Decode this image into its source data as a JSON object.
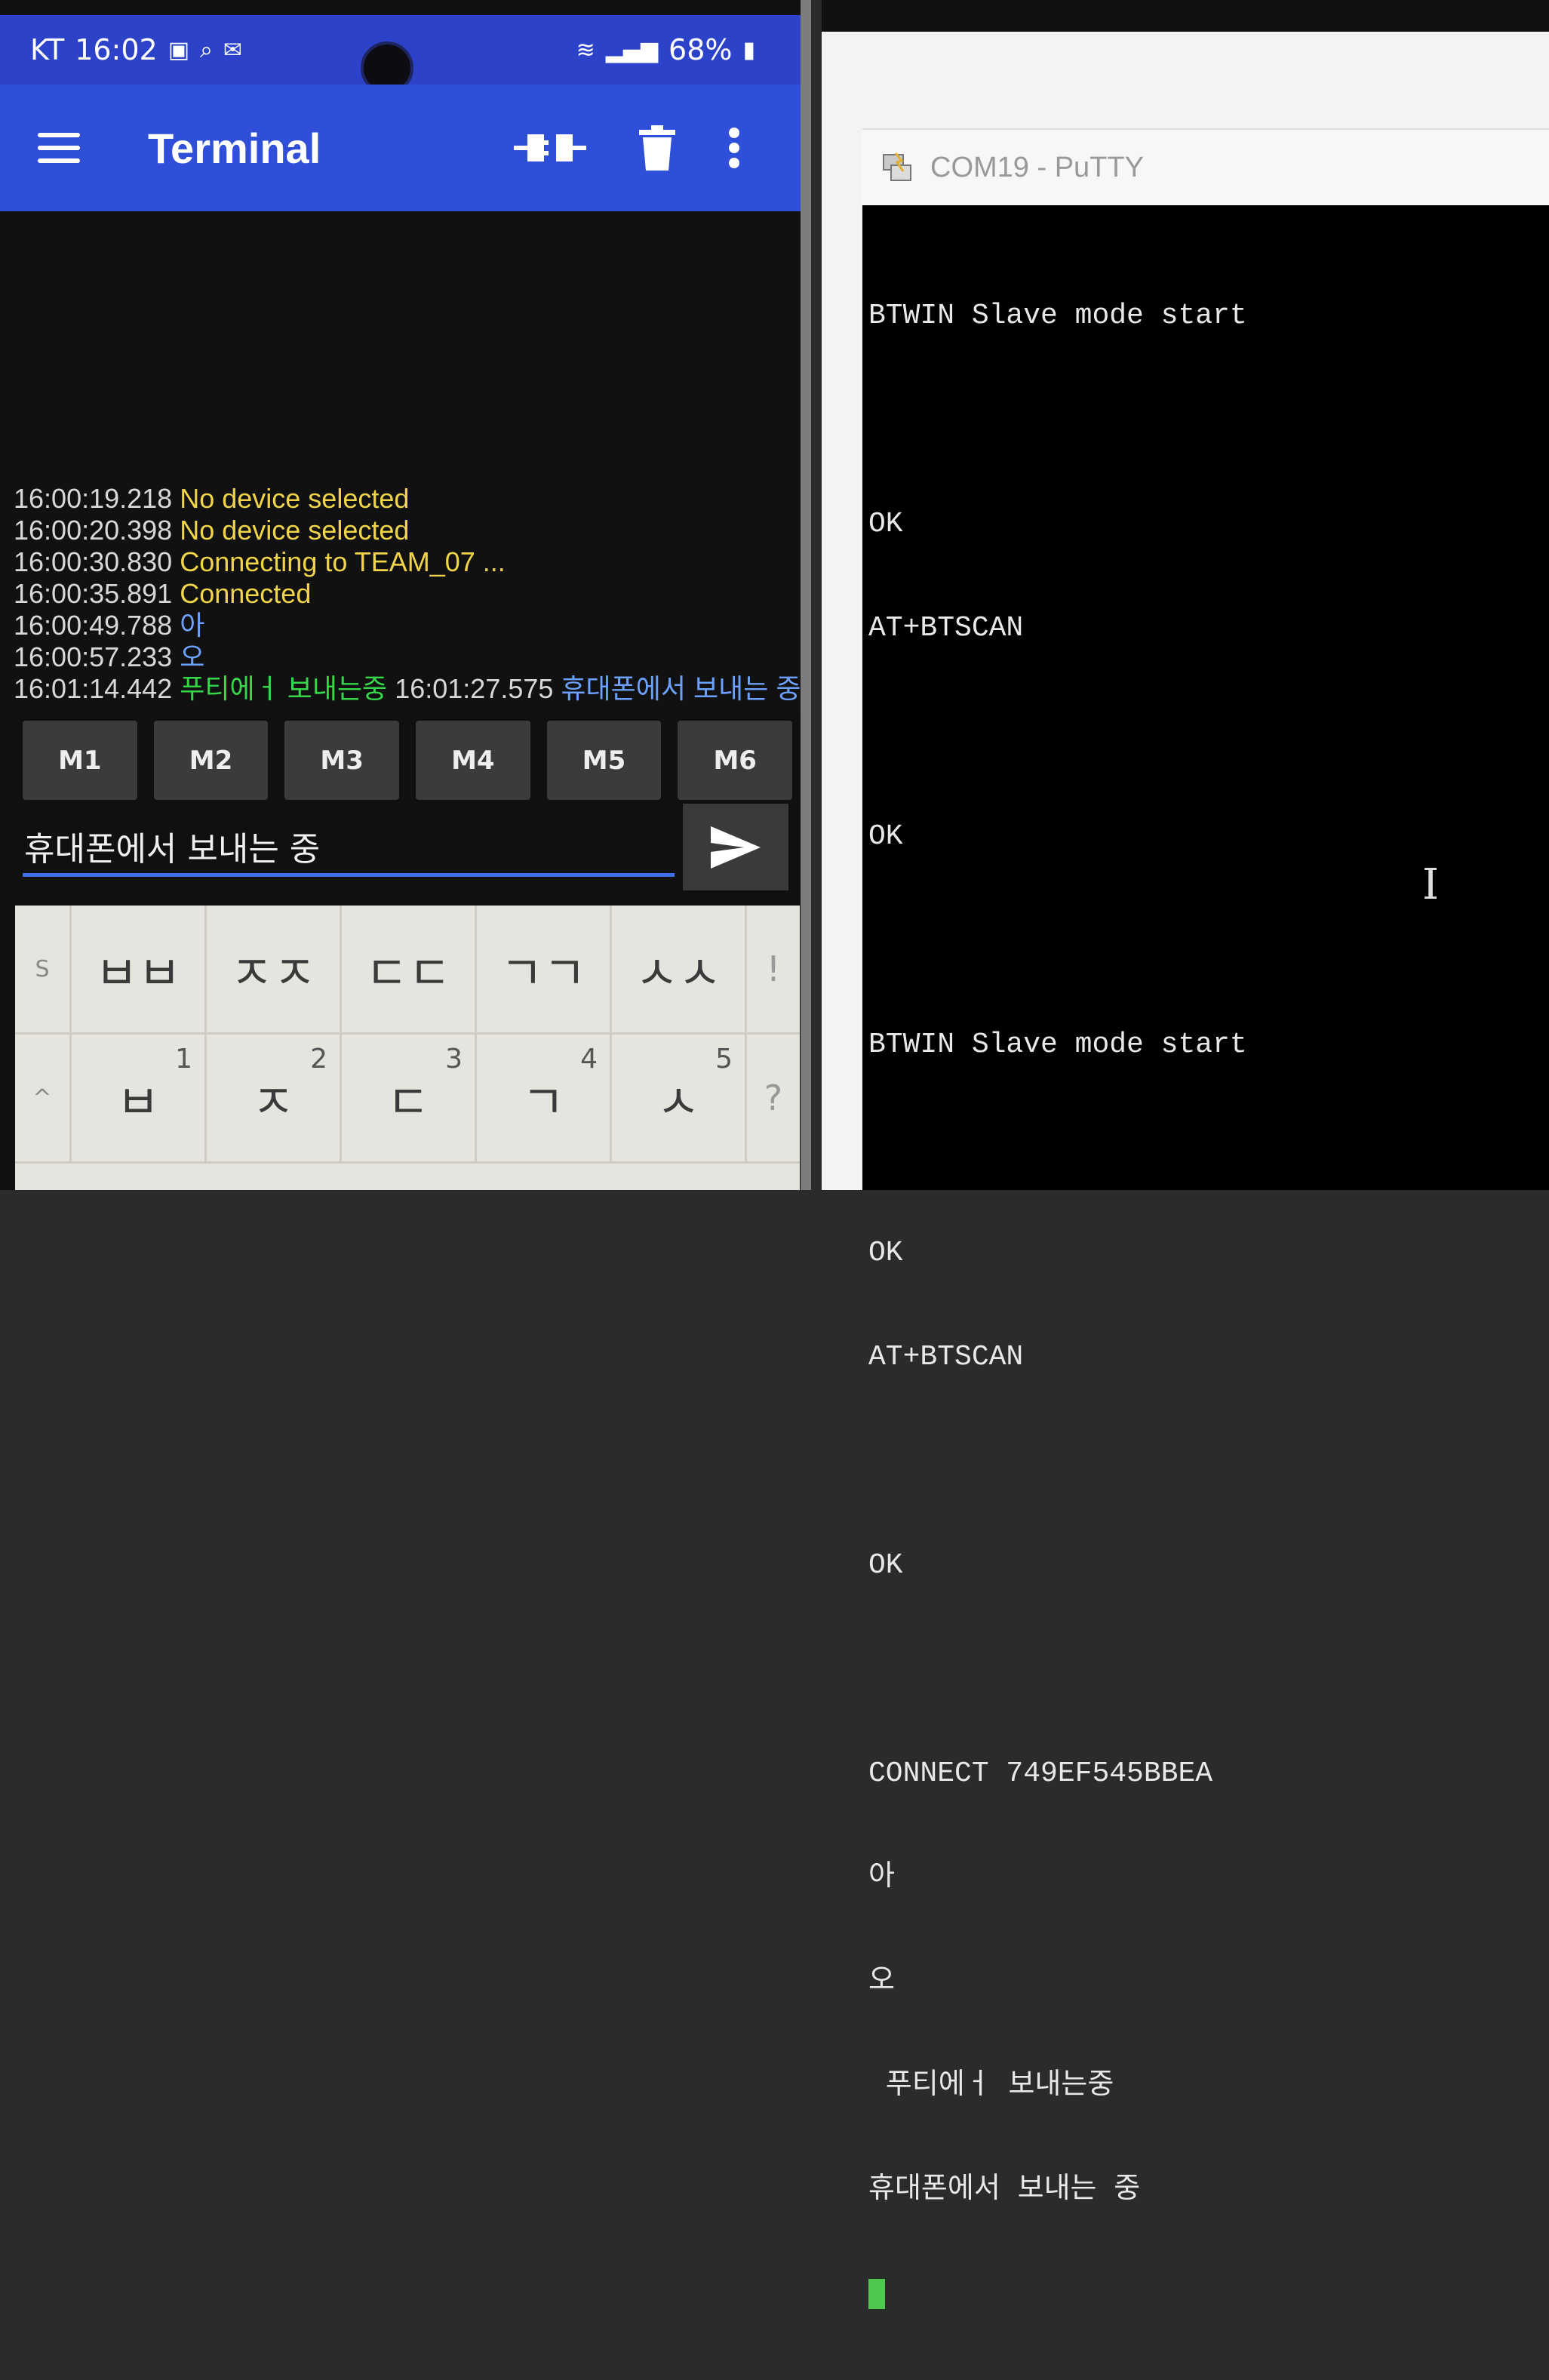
{
  "phone": {
    "status_bar": {
      "carrier": "KT",
      "time": "16:02",
      "battery": "68%"
    },
    "app_bar": {
      "title": "Terminal",
      "icons": [
        "menu-icon",
        "connect-icon",
        "delete-icon",
        "more-icon"
      ]
    },
    "log": [
      {
        "time": "16:00:19.218",
        "text": "No device selected",
        "kind": "status"
      },
      {
        "time": "16:00:20.398",
        "text": "No device selected",
        "kind": "status"
      },
      {
        "time": "16:00:30.830",
        "text": "Connecting to TEAM_07 ...",
        "kind": "status"
      },
      {
        "time": "16:00:35.891",
        "text": "Connected",
        "kind": "status"
      },
      {
        "time": "16:00:49.788",
        "text": "아",
        "kind": "recv"
      },
      {
        "time": "16:00:57.233",
        "text": "오",
        "kind": "recv"
      },
      {
        "time": "16:01:14.442",
        "text": "푸티에ㅓ 보내는중",
        "kind": "send",
        "time2": "16:01:27.575",
        "text2": "휴대폰에서 보내는 중"
      }
    ],
    "macros": [
      "M1",
      "M2",
      "M3",
      "M4",
      "M5",
      "M6"
    ],
    "input": {
      "value": "휴대폰에서 보내는 중"
    },
    "keyboard": {
      "row1": [
        "ㅂㅂ",
        "ㅈㅈ",
        "ㄷㄷ",
        "ㄱㄱ",
        "ㅅㅅ"
      ],
      "row1_side": "S",
      "row1_edge": "!",
      "row2": [
        {
          "char": "ㅂ",
          "num": "1"
        },
        {
          "char": "ㅈ",
          "num": "2"
        },
        {
          "char": "ㄷ",
          "num": "3"
        },
        {
          "char": "ㄱ",
          "num": "4"
        },
        {
          "char": "ㅅ",
          "num": "5"
        }
      ],
      "row2_side": "^",
      "row2_edge": "?"
    }
  },
  "putty": {
    "title": "COM19 - PuTTY",
    "lines": [
      "BTWIN Slave mode start",
      "",
      "OK",
      "AT+BTSCAN",
      "",
      "OK",
      "",
      "BTWIN Slave mode start",
      "",
      "OK",
      "AT+BTSCAN",
      "",
      "OK",
      "",
      "CONNECT 749EF545BBEA",
      "아",
      "오",
      " 푸티에ㅓ 보내는중",
      "휴대폰에서 보내는 중"
    ],
    "cursor_color": "#4ec94e"
  },
  "colors": {
    "app_bar": "#2f4fd8",
    "status_text": "#f0d54a",
    "recv_text": "#6da1ff",
    "send_text": "#36d84a",
    "input_underline": "#3f6fe6"
  }
}
